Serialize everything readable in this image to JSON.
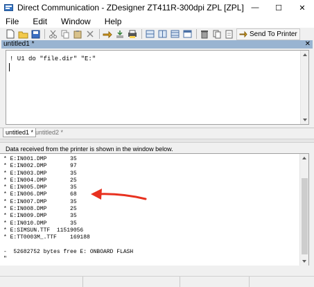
{
  "window": {
    "title": "Direct Communication - ZDesigner ZT411R-300dpi ZPL [ZPL]",
    "minimize_glyph": "—",
    "maximize_glyph": "☐",
    "close_glyph": "✕"
  },
  "menu": [
    "File",
    "Edit",
    "Window",
    "Help"
  ],
  "toolbar": {
    "icons": [
      "new-icon",
      "open-icon",
      "save-icon",
      "cut-icon",
      "copy-icon",
      "paste-icon",
      "delete-icon",
      "send-file-icon",
      "receive-icon",
      "printer-settings-icon",
      "split-view-icon",
      "tile-horizontal-icon",
      "tile-vertical-icon",
      "window-icon",
      "clear-icon",
      "copy-output-icon",
      "save-output-icon"
    ],
    "send_label": "Send To Printer"
  },
  "document": {
    "header_label": "untitled1 *",
    "close_glyph": "✕",
    "command": "! U1 do \"file.dir\" \"E:\""
  },
  "tabs": [
    "untitled1 *",
    "untitled2 *"
  ],
  "status_message": "Data received from the printer is shown in the window below.",
  "output": {
    "lines": [
      "* E:IN001.DMP       35",
      "* E:IN002.DMP       97",
      "* E:IN003.DMP       35",
      "* E:IN004.DMP       25",
      "* E:IN005.DMP       35",
      "* E:IN006.DMP       68",
      "* E:IN007.DMP       35",
      "* E:IN008.DMP       25",
      "* E:IN009.DMP       35",
      "* E:IN010.DMP       35",
      "* E:SIMSUN.TTF  11519056",
      "* E:TT0003M_.TTF    169188",
      "",
      "-  52682752 bytes free E: ONBOARD FLASH",
      "\""
    ],
    "highlighted_line": "* E:IN006.DMP       68"
  },
  "colors": {
    "accent_header": "#99b4d1",
    "annotation_arrow": "#e8311f"
  }
}
